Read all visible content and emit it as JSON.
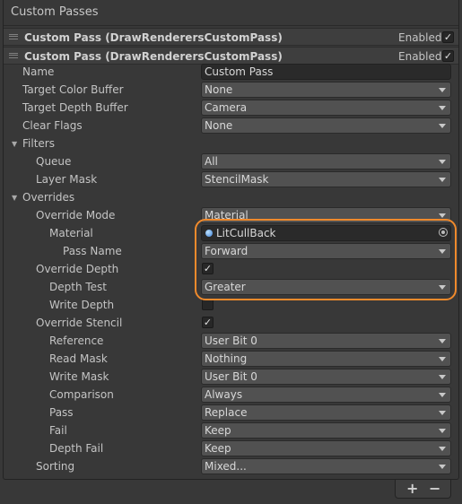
{
  "panel": {
    "title": "Custom Passes"
  },
  "passes": [
    {
      "title": "Custom Pass (DrawRenderersCustomPass)",
      "enabled_label": "Enabled",
      "enabled": true
    },
    {
      "title": "Custom Pass (DrawRenderersCustomPass)",
      "enabled_label": "Enabled",
      "enabled": true
    }
  ],
  "props": {
    "name": {
      "label": "Name",
      "value": "Custom Pass"
    },
    "target_color": {
      "label": "Target Color Buffer",
      "value": "None"
    },
    "target_depth": {
      "label": "Target Depth Buffer",
      "value": "Camera"
    },
    "clear_flags": {
      "label": "Clear Flags",
      "value": "None"
    },
    "filters": {
      "label": "Filters"
    },
    "queue": {
      "label": "Queue",
      "value": "All"
    },
    "layer_mask": {
      "label": "Layer Mask",
      "value": "StencilMask"
    },
    "overrides": {
      "label": "Overrides"
    },
    "override_mode": {
      "label": "Override Mode",
      "value": "Material"
    },
    "material": {
      "label": "Material",
      "value": "LitCullBack"
    },
    "pass_name": {
      "label": "Pass Name",
      "value": "Forward"
    },
    "override_depth": {
      "label": "Override Depth",
      "checked": true
    },
    "depth_test": {
      "label": "Depth Test",
      "value": "Greater"
    },
    "write_depth": {
      "label": "Write Depth",
      "checked": false
    },
    "override_stencil": {
      "label": "Override Stencil",
      "checked": true
    },
    "reference": {
      "label": "Reference",
      "value": "User Bit 0"
    },
    "read_mask": {
      "label": "Read Mask",
      "value": "Nothing"
    },
    "write_mask": {
      "label": "Write Mask",
      "value": "User Bit 0"
    },
    "comparison": {
      "label": "Comparison",
      "value": "Always"
    },
    "pass": {
      "label": "Pass",
      "value": "Replace"
    },
    "fail": {
      "label": "Fail",
      "value": "Keep"
    },
    "depth_fail": {
      "label": "Depth Fail",
      "value": "Keep"
    },
    "sorting": {
      "label": "Sorting",
      "value": "Mixed..."
    }
  },
  "footer": {
    "add_label": "+",
    "remove_label": "−"
  },
  "icons": {
    "checkmark": "✓"
  },
  "colors": {
    "highlight": "#f08a2c",
    "background": "#383838"
  }
}
